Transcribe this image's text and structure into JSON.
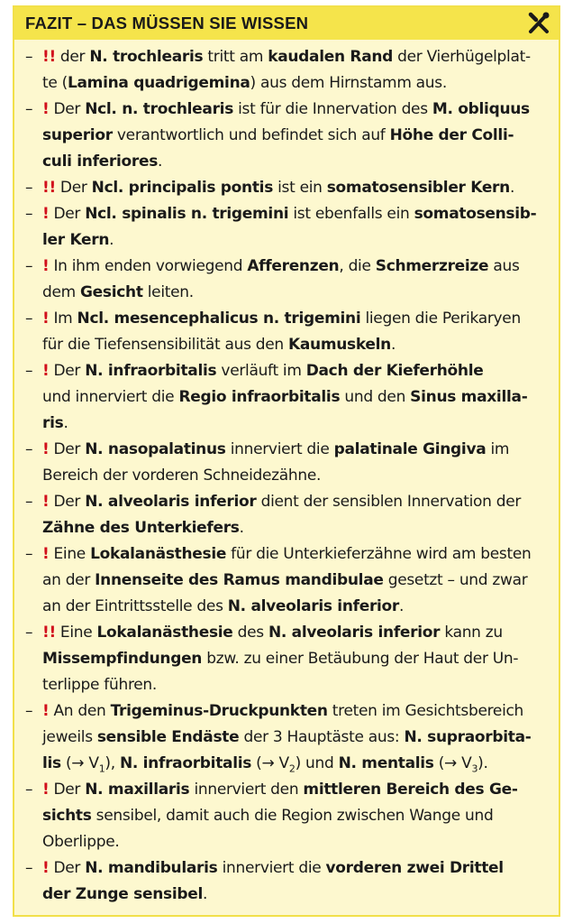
{
  "header": {
    "title": "FAZIT – DAS MÜSSEN SIE WISSEN",
    "icon": "crossed-tools-icon"
  },
  "colors": {
    "accent": "#f5e44b",
    "background": "#fdf8cf",
    "mark": "#d10f1c"
  },
  "items": [
    {
      "mark": "!!",
      "parts": [
        {
          "t": "der "
        },
        {
          "b": "N. trochlearis"
        },
        {
          "t": " tritt am "
        },
        {
          "b": "kaudalen Rand"
        },
        {
          "t": " der Vierhügelplat-"
        },
        {
          "br": 1
        },
        {
          "t": "te ("
        },
        {
          "b": "Lamina quadrigemina"
        },
        {
          "t": ") aus dem Hirnstamm aus."
        }
      ]
    },
    {
      "mark": "!",
      "parts": [
        {
          "t": "Der "
        },
        {
          "b": "Ncl. n. trochlearis"
        },
        {
          "t": " ist für die Innervation des "
        },
        {
          "b": "M. obliquus"
        },
        {
          "br": 1
        },
        {
          "b": "superior"
        },
        {
          "t": " verantwortlich und befindet sich auf "
        },
        {
          "b": "Höhe der Colli-"
        },
        {
          "br": 1
        },
        {
          "b": "culi inferiores"
        },
        {
          "t": "."
        }
      ]
    },
    {
      "mark": "!!",
      "parts": [
        {
          "t": "Der "
        },
        {
          "b": "Ncl. principalis pontis"
        },
        {
          "t": " ist ein "
        },
        {
          "b": "somatosensibler Kern"
        },
        {
          "t": "."
        }
      ]
    },
    {
      "mark": "!",
      "parts": [
        {
          "t": "Der "
        },
        {
          "b": "Ncl. spinalis n. trigemini"
        },
        {
          "t": " ist ebenfalls ein "
        },
        {
          "b": "somatosensib-"
        },
        {
          "br": 1
        },
        {
          "b": "ler Kern"
        },
        {
          "t": "."
        }
      ]
    },
    {
      "mark": "!",
      "parts": [
        {
          "t": "In ihm enden vorwiegend "
        },
        {
          "b": "Afferenzen"
        },
        {
          "t": ", die "
        },
        {
          "b": "Schmerzreize"
        },
        {
          "t": " aus"
        },
        {
          "br": 1
        },
        {
          "t": "dem "
        },
        {
          "b": "Gesicht"
        },
        {
          "t": " leiten."
        }
      ]
    },
    {
      "mark": "!",
      "parts": [
        {
          "t": "Im "
        },
        {
          "b": "Ncl. mesencephalicus n. trigemini"
        },
        {
          "t": " liegen die Perikaryen"
        },
        {
          "br": 1
        },
        {
          "t": "für die Tiefensensibilität aus den "
        },
        {
          "b": "Kaumuskeln"
        },
        {
          "t": "."
        }
      ]
    },
    {
      "mark": "!",
      "parts": [
        {
          "t": "Der "
        },
        {
          "b": "N. infraorbitalis"
        },
        {
          "t": " verläuft im "
        },
        {
          "b": "Dach der Kieferhöhle"
        },
        {
          "br": 1
        },
        {
          "t": "und innerviert die "
        },
        {
          "b": "Regio infraorbitalis"
        },
        {
          "t": " und den "
        },
        {
          "b": "Sinus maxilla-"
        },
        {
          "br": 1
        },
        {
          "b": "ris"
        },
        {
          "t": "."
        }
      ]
    },
    {
      "mark": "!",
      "parts": [
        {
          "t": "Der "
        },
        {
          "b": "N. nasopalatinus"
        },
        {
          "t": " innerviert die "
        },
        {
          "b": "palatinale Gingiva"
        },
        {
          "t": " im"
        },
        {
          "br": 1
        },
        {
          "t": "Bereich der vorderen Schneidezähne."
        }
      ]
    },
    {
      "mark": "!",
      "parts": [
        {
          "t": "Der "
        },
        {
          "b": "N. alveolaris inferior"
        },
        {
          "t": " dient der sensiblen Innervation der"
        },
        {
          "br": 1
        },
        {
          "b": "Zähne des Unterkiefers"
        },
        {
          "t": "."
        }
      ]
    },
    {
      "mark": "!",
      "parts": [
        {
          "t": "Eine "
        },
        {
          "b": "Lokalanästhesie"
        },
        {
          "t": " für die Unterkieferzähne wird am besten"
        },
        {
          "br": 1
        },
        {
          "t": "an der "
        },
        {
          "b": "Innenseite des Ramus mandibulae"
        },
        {
          "t": " gesetzt – und zwar"
        },
        {
          "br": 1
        },
        {
          "t": "an der Eintrittsstelle des "
        },
        {
          "b": "N. alveolaris inferior"
        },
        {
          "t": "."
        }
      ]
    },
    {
      "mark": "!!",
      "parts": [
        {
          "t": "Eine "
        },
        {
          "b": "Lokalanästhesie"
        },
        {
          "t": " des "
        },
        {
          "b": "N. alveolaris inferior"
        },
        {
          "t": " kann zu"
        },
        {
          "br": 1
        },
        {
          "b": "Missempfindungen"
        },
        {
          "t": " bzw. zu einer Betäubung der Haut der Un-"
        },
        {
          "br": 1
        },
        {
          "t": "terlippe führen."
        }
      ]
    },
    {
      "mark": "!",
      "parts": [
        {
          "t": "An den "
        },
        {
          "b": "Trigeminus-Druckpunkten"
        },
        {
          "t": " treten im Gesichtsbereich"
        },
        {
          "br": 1
        },
        {
          "t": "jeweils "
        },
        {
          "b": "sensible Endäste"
        },
        {
          "t": " der 3 Hauptäste aus: "
        },
        {
          "b": "N. supraorbita-"
        },
        {
          "br": 1
        },
        {
          "b": "lis"
        },
        {
          "t": " (→ V"
        },
        {
          "sub": "1"
        },
        {
          "t": "), "
        },
        {
          "b": "N. infraorbitalis"
        },
        {
          "t": " (→ V"
        },
        {
          "sub": "2"
        },
        {
          "t": ") und "
        },
        {
          "b": "N. mentalis"
        },
        {
          "t": " (→ V"
        },
        {
          "sub": "3"
        },
        {
          "t": ")."
        }
      ]
    },
    {
      "mark": "!",
      "parts": [
        {
          "t": "Der "
        },
        {
          "b": "N. maxillaris"
        },
        {
          "t": " innerviert den "
        },
        {
          "b": "mittleren Bereich des Ge-"
        },
        {
          "br": 1
        },
        {
          "b": "sichts"
        },
        {
          "t": " sensibel, damit auch die Region zwischen Wange und"
        },
        {
          "br": 1
        },
        {
          "t": "Oberlippe."
        }
      ]
    },
    {
      "mark": "!",
      "parts": [
        {
          "t": "Der "
        },
        {
          "b": "N. mandibularis"
        },
        {
          "t": " innerviert die "
        },
        {
          "b": "vorderen zwei Drittel"
        },
        {
          "br": 1
        },
        {
          "b": "der Zunge sensibel"
        },
        {
          "t": "."
        }
      ]
    }
  ]
}
